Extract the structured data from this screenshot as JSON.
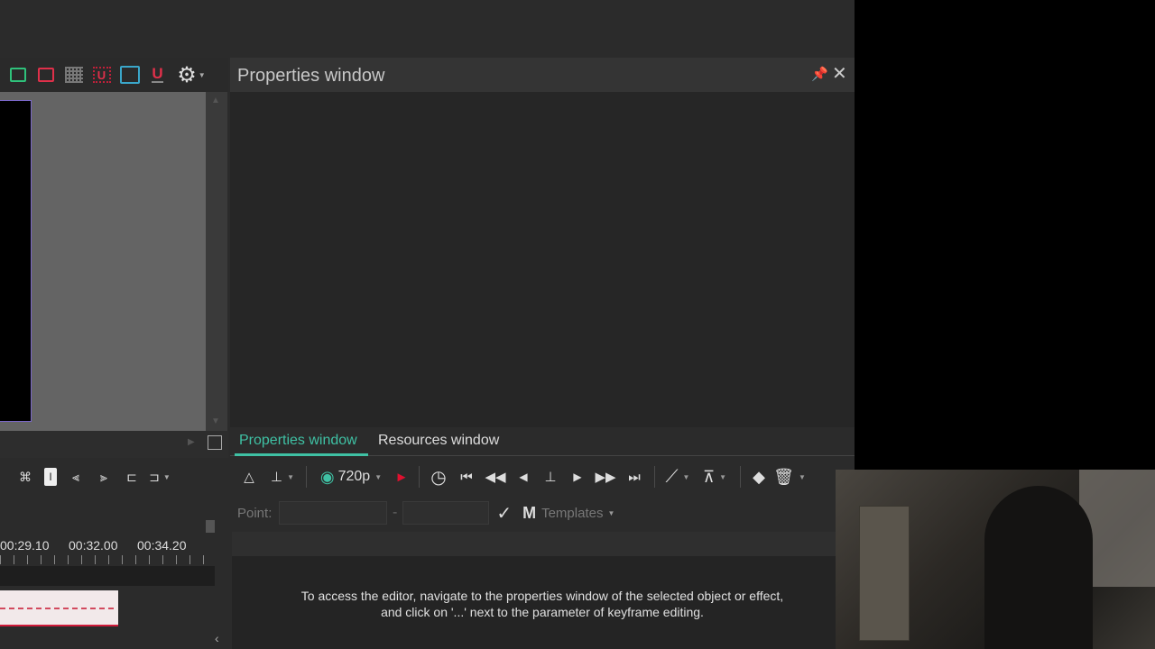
{
  "properties_panel": {
    "title": "Properties window",
    "pin_icon": "pin-icon",
    "close_icon": "close-icon"
  },
  "tabs": [
    {
      "label": "Properties window",
      "active": true
    },
    {
      "label": "Resources window",
      "active": false
    }
  ],
  "keyframe_toolbar": {
    "resolution": "720p",
    "point_label": "Point:",
    "templates_label": "Templates"
  },
  "editor_hint": {
    "line1": "To access the editor, navigate to the properties window of the selected object or effect,",
    "line2": "and click on '...' next to the parameter of keyframe editing."
  },
  "timeline": {
    "timecodes": [
      "00:29.10",
      "00:32.00",
      "00:34.20"
    ]
  },
  "colors": {
    "accent": "#3fc1a4",
    "record": "#e0102f",
    "clip_border": "#d01a3a",
    "frame_border": "#7a67c9"
  }
}
